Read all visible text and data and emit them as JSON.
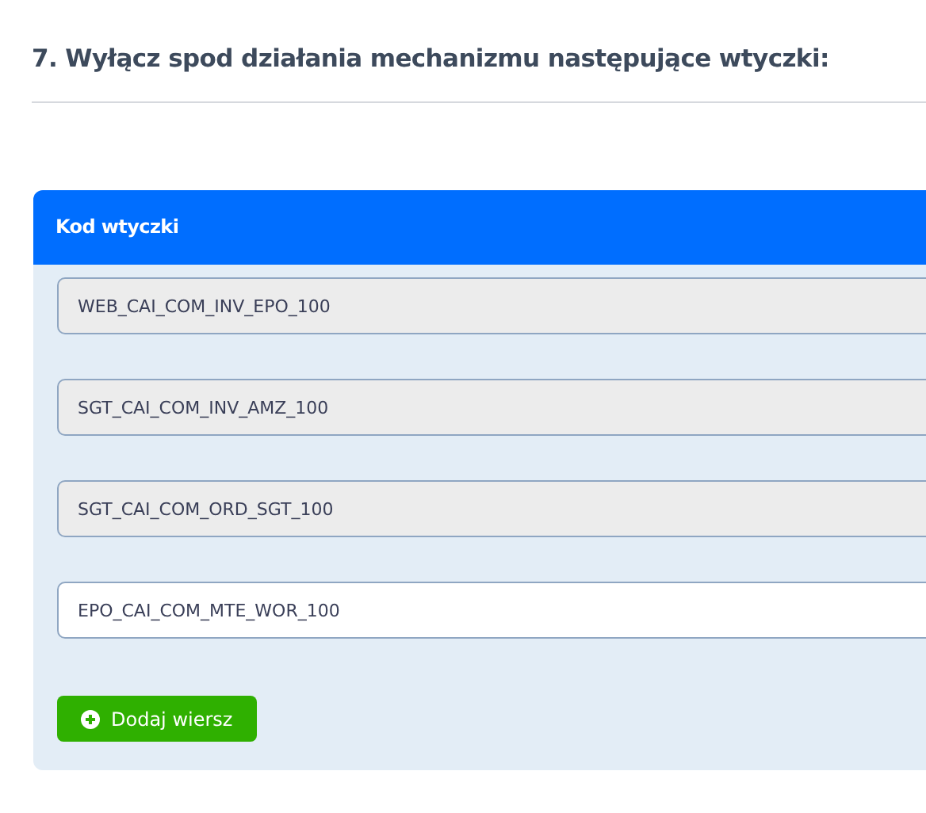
{
  "heading": "7. Wyłącz spod działania mechanizmu następujące wtyczki:",
  "table": {
    "column_header": "Kod wtyczki",
    "rows": [
      {
        "value": "WEB_CAI_COM_INV_EPO_100",
        "disabled": true
      },
      {
        "value": "SGT_CAI_COM_INV_AMZ_100",
        "disabled": true
      },
      {
        "value": "SGT_CAI_COM_ORD_SGT_100",
        "disabled": true
      },
      {
        "value": "EPO_CAI_COM_MTE_WOR_100",
        "disabled": false
      }
    ]
  },
  "add_button": {
    "label": "Dodaj wiersz"
  }
}
